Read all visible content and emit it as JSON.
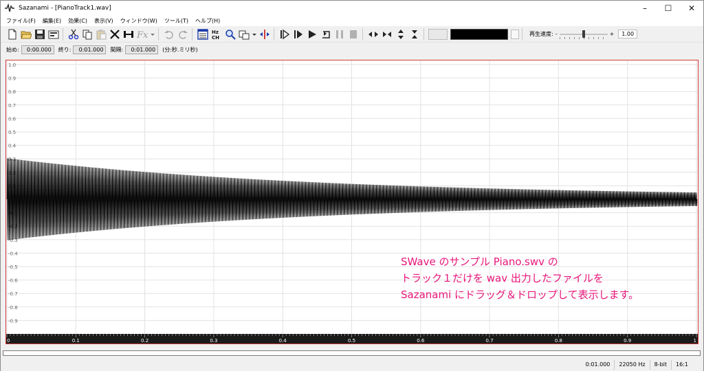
{
  "window": {
    "title": "Sazanami - [PianoTrack1.wav]",
    "minimize": "–",
    "maximize": "☐",
    "close": "✕"
  },
  "menu": [
    "ファイル(F)",
    "編集(E)",
    "効果(C)",
    "表示(V)",
    "ウィンドウ(W)",
    "ツール(T)",
    "ヘルプ(H)"
  ],
  "toolbar": {
    "speed_label": "再生速度:",
    "speed_minus": "-",
    "speed_plus": "+",
    "speed_value": "1.00",
    "speed_level": 0.5
  },
  "timebar": {
    "start_label": "始め:",
    "start_value": "0:00.000",
    "end_label": "終り:",
    "end_value": "0:01.000",
    "interval_label": "間隔:",
    "interval_value": "0:01.000",
    "unit_label": "(分:秒.ミリ秒)"
  },
  "waveform": {
    "y_labels": [
      "1.0",
      "0.9",
      "0.8",
      "0.7",
      "0.6",
      "0.5",
      "0.4",
      "0.3",
      "0.2",
      "0.1",
      "",
      "-0.1",
      "-0.2",
      "-0.3",
      "-0.4",
      "-0.5",
      "-0.6",
      "-0.7",
      "-0.8",
      "-0.9"
    ],
    "x_labels": [
      "0",
      "0.1",
      "0.2",
      "0.3",
      "0.4",
      "0.5",
      "0.6",
      "0.7",
      "0.8",
      "0.9",
      "1"
    ],
    "start_amplitude": 0.32,
    "end_amplitude": 0.02
  },
  "annotation": {
    "line1": "SWave のサンプル Piano.swv の",
    "line2": "トラック１だけを wav 出力したファイルを",
    "line3": "Sazanami にドラッグ＆ドロップして表示します。"
  },
  "status": {
    "time": "0:01.000",
    "rate": "22050 Hz",
    "bits": "8-bit",
    "zoom": "16:1"
  },
  "colors": {
    "annotation": "#e8157a",
    "wave_border": "#d23a3a",
    "waveform": "#000000"
  }
}
